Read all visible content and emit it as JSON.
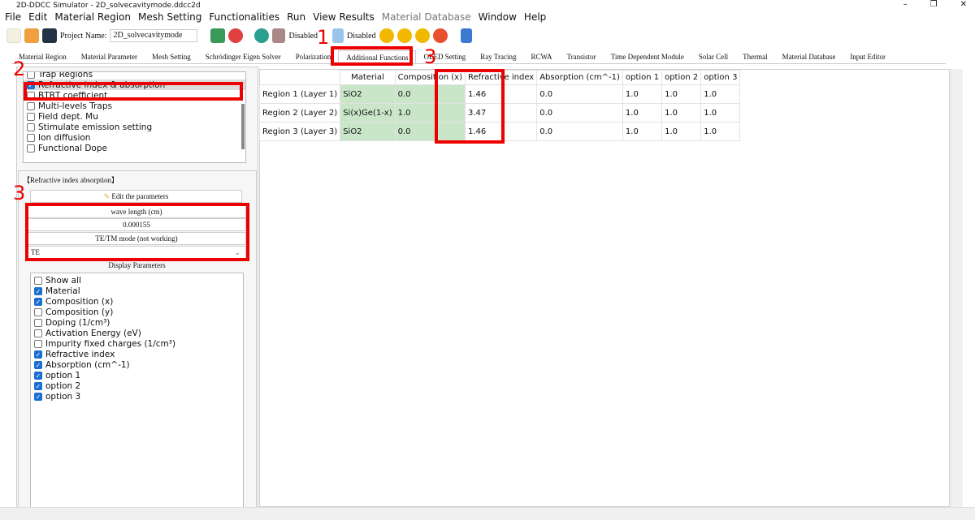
{
  "window": {
    "title": "2D-DDCC Simulator - 2D_solvecavitymode.ddcc2d",
    "controls": [
      "–",
      "❐",
      "✕"
    ]
  },
  "menu": [
    {
      "label": "File"
    },
    {
      "label": "Edit"
    },
    {
      "label": "Material Region"
    },
    {
      "label": "Mesh Setting"
    },
    {
      "label": "Functionalities"
    },
    {
      "label": "Run"
    },
    {
      "label": "View Results"
    },
    {
      "label": "Material Database",
      "disabled": true
    },
    {
      "label": "Window"
    },
    {
      "label": "Help"
    }
  ],
  "toolbar": {
    "project_label": "Project Name:",
    "project_name": "2D_solvecavitymode",
    "status1": "Disabled",
    "status2": "Disabled"
  },
  "tabs": [
    {
      "label": "Material Region"
    },
    {
      "label": "Material Parameter"
    },
    {
      "label": "Mesh Setting"
    },
    {
      "label": "Schrödinger Eigen Solver"
    },
    {
      "label": "Polarization"
    },
    {
      "label": "Additional Functions",
      "active": true
    },
    {
      "label": "OLED Setting"
    },
    {
      "label": "Ray Tracing"
    },
    {
      "label": "RCWA"
    },
    {
      "label": "Transistor"
    },
    {
      "label": "Time Dependent Module"
    },
    {
      "label": "Solar Cell"
    },
    {
      "label": "Thermal"
    },
    {
      "label": "Material Database"
    },
    {
      "label": "Input Editor"
    }
  ],
  "functions": [
    {
      "label": "Trap Regions",
      "checked": false
    },
    {
      "label": "Refractive index & absorption",
      "checked": true,
      "selected": true
    },
    {
      "label": "BTBT coefficient",
      "checked": false
    },
    {
      "label": "Multi-levels Traps",
      "checked": false
    },
    {
      "label": "Field dept. Mu",
      "checked": false
    },
    {
      "label": "Stimulate emission setting",
      "checked": false
    },
    {
      "label": "Ion diffusion",
      "checked": false
    },
    {
      "label": "Functional Dope",
      "checked": false
    }
  ],
  "params": {
    "group_title": "【Refractive index  absorption】",
    "edit_button": "Edit the parameters",
    "wavelength_label": "wave length (cm)",
    "wavelength_value": "0.000155",
    "mode_label": "TE/TM mode (not working)",
    "mode_value": "TE",
    "display_title": "Display Parameters"
  },
  "display": [
    {
      "label": "Show all",
      "checked": false
    },
    {
      "label": "Material",
      "checked": true
    },
    {
      "label": "Composition (x)",
      "checked": true
    },
    {
      "label": "Composition (y)",
      "checked": false
    },
    {
      "label": "Doping (1/cm³)",
      "checked": false
    },
    {
      "label": "Activation Energy (eV)",
      "checked": false
    },
    {
      "label": "Impurity fixed charges (1/cm³)",
      "checked": false
    },
    {
      "label": "Refractive index",
      "checked": true
    },
    {
      "label": "Absorption (cm^-1)",
      "checked": true
    },
    {
      "label": "option 1",
      "checked": true
    },
    {
      "label": "option 2",
      "checked": true
    },
    {
      "label": "option 3",
      "checked": true
    }
  ],
  "table": {
    "columns": [
      "Material",
      "Composition (x)",
      "Refractive index",
      "Absorption (cm^-1)",
      "option 1",
      "option 2",
      "option 3"
    ],
    "rows": [
      {
        "header": "Region 1 (Layer 1)",
        "cells": [
          "SiO2",
          "0.0",
          "1.46",
          "0.0",
          "1.0",
          "1.0",
          "1.0"
        ]
      },
      {
        "header": "Region 2 (Layer 2)",
        "cells": [
          "Si(x)Ge(1-x)",
          "1.0",
          "3.47",
          "0.0",
          "1.0",
          "1.0",
          "1.0"
        ]
      },
      {
        "header": "Region 3 (Layer 3)",
        "cells": [
          "SiO2",
          "0.0",
          "1.46",
          "0.0",
          "1.0",
          "1.0",
          "1.0"
        ]
      }
    ]
  },
  "annotations": [
    "1",
    "2",
    "3",
    "3"
  ],
  "colors": {
    "highlight": "#e00000",
    "material_cell": "#c9e6c9",
    "checkbox": "#1a6fd0"
  }
}
